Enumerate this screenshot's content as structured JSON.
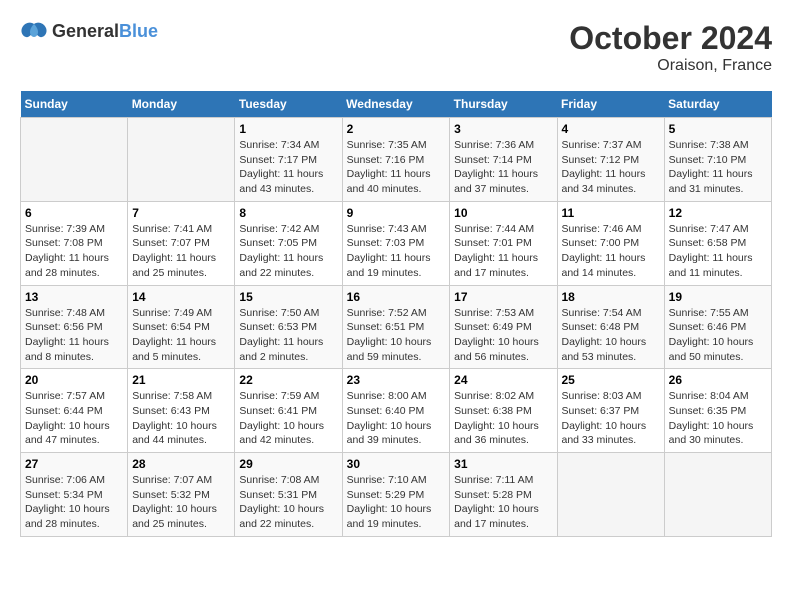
{
  "header": {
    "logo": {
      "text_general": "General",
      "text_blue": "Blue"
    },
    "title": "October 2024",
    "subtitle": "Oraison, France"
  },
  "weekdays": [
    "Sunday",
    "Monday",
    "Tuesday",
    "Wednesday",
    "Thursday",
    "Friday",
    "Saturday"
  ],
  "weeks": [
    [
      {
        "day": "",
        "empty": true
      },
      {
        "day": "",
        "empty": true
      },
      {
        "day": "1",
        "sunrise": "7:34 AM",
        "sunset": "7:17 PM",
        "daylight": "11 hours and 43 minutes."
      },
      {
        "day": "2",
        "sunrise": "7:35 AM",
        "sunset": "7:16 PM",
        "daylight": "11 hours and 40 minutes."
      },
      {
        "day": "3",
        "sunrise": "7:36 AM",
        "sunset": "7:14 PM",
        "daylight": "11 hours and 37 minutes."
      },
      {
        "day": "4",
        "sunrise": "7:37 AM",
        "sunset": "7:12 PM",
        "daylight": "11 hours and 34 minutes."
      },
      {
        "day": "5",
        "sunrise": "7:38 AM",
        "sunset": "7:10 PM",
        "daylight": "11 hours and 31 minutes."
      }
    ],
    [
      {
        "day": "6",
        "sunrise": "7:39 AM",
        "sunset": "7:08 PM",
        "daylight": "11 hours and 28 minutes."
      },
      {
        "day": "7",
        "sunrise": "7:41 AM",
        "sunset": "7:07 PM",
        "daylight": "11 hours and 25 minutes."
      },
      {
        "day": "8",
        "sunrise": "7:42 AM",
        "sunset": "7:05 PM",
        "daylight": "11 hours and 22 minutes."
      },
      {
        "day": "9",
        "sunrise": "7:43 AM",
        "sunset": "7:03 PM",
        "daylight": "11 hours and 19 minutes."
      },
      {
        "day": "10",
        "sunrise": "7:44 AM",
        "sunset": "7:01 PM",
        "daylight": "11 hours and 17 minutes."
      },
      {
        "day": "11",
        "sunrise": "7:46 AM",
        "sunset": "7:00 PM",
        "daylight": "11 hours and 14 minutes."
      },
      {
        "day": "12",
        "sunrise": "7:47 AM",
        "sunset": "6:58 PM",
        "daylight": "11 hours and 11 minutes."
      }
    ],
    [
      {
        "day": "13",
        "sunrise": "7:48 AM",
        "sunset": "6:56 PM",
        "daylight": "11 hours and 8 minutes."
      },
      {
        "day": "14",
        "sunrise": "7:49 AM",
        "sunset": "6:54 PM",
        "daylight": "11 hours and 5 minutes."
      },
      {
        "day": "15",
        "sunrise": "7:50 AM",
        "sunset": "6:53 PM",
        "daylight": "11 hours and 2 minutes."
      },
      {
        "day": "16",
        "sunrise": "7:52 AM",
        "sunset": "6:51 PM",
        "daylight": "10 hours and 59 minutes."
      },
      {
        "day": "17",
        "sunrise": "7:53 AM",
        "sunset": "6:49 PM",
        "daylight": "10 hours and 56 minutes."
      },
      {
        "day": "18",
        "sunrise": "7:54 AM",
        "sunset": "6:48 PM",
        "daylight": "10 hours and 53 minutes."
      },
      {
        "day": "19",
        "sunrise": "7:55 AM",
        "sunset": "6:46 PM",
        "daylight": "10 hours and 50 minutes."
      }
    ],
    [
      {
        "day": "20",
        "sunrise": "7:57 AM",
        "sunset": "6:44 PM",
        "daylight": "10 hours and 47 minutes."
      },
      {
        "day": "21",
        "sunrise": "7:58 AM",
        "sunset": "6:43 PM",
        "daylight": "10 hours and 44 minutes."
      },
      {
        "day": "22",
        "sunrise": "7:59 AM",
        "sunset": "6:41 PM",
        "daylight": "10 hours and 42 minutes."
      },
      {
        "day": "23",
        "sunrise": "8:00 AM",
        "sunset": "6:40 PM",
        "daylight": "10 hours and 39 minutes."
      },
      {
        "day": "24",
        "sunrise": "8:02 AM",
        "sunset": "6:38 PM",
        "daylight": "10 hours and 36 minutes."
      },
      {
        "day": "25",
        "sunrise": "8:03 AM",
        "sunset": "6:37 PM",
        "daylight": "10 hours and 33 minutes."
      },
      {
        "day": "26",
        "sunrise": "8:04 AM",
        "sunset": "6:35 PM",
        "daylight": "10 hours and 30 minutes."
      }
    ],
    [
      {
        "day": "27",
        "sunrise": "7:06 AM",
        "sunset": "5:34 PM",
        "daylight": "10 hours and 28 minutes."
      },
      {
        "day": "28",
        "sunrise": "7:07 AM",
        "sunset": "5:32 PM",
        "daylight": "10 hours and 25 minutes."
      },
      {
        "day": "29",
        "sunrise": "7:08 AM",
        "sunset": "5:31 PM",
        "daylight": "10 hours and 22 minutes."
      },
      {
        "day": "30",
        "sunrise": "7:10 AM",
        "sunset": "5:29 PM",
        "daylight": "10 hours and 19 minutes."
      },
      {
        "day": "31",
        "sunrise": "7:11 AM",
        "sunset": "5:28 PM",
        "daylight": "10 hours and 17 minutes."
      },
      {
        "day": "",
        "empty": true
      },
      {
        "day": "",
        "empty": true
      }
    ]
  ],
  "labels": {
    "sunrise": "Sunrise:",
    "sunset": "Sunset:",
    "daylight": "Daylight:"
  }
}
